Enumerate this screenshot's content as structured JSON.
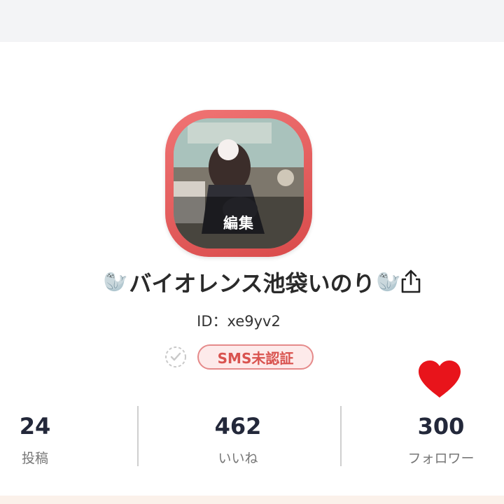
{
  "profile": {
    "edit_label": "編集",
    "name_prefix_emoji": "🦭",
    "display_name": "バイオレンス池袋いのり",
    "name_suffix_emoji": "🦭",
    "user_id": "ID：xe9yv2",
    "sms_status": "SMS未認証",
    "share_icon": "share-icon",
    "verify_icon": "check-circle-icon",
    "favorite_icon": "heart-icon"
  },
  "stats": [
    {
      "value": "24",
      "label": "投稿"
    },
    {
      "value": "462",
      "label": "いいね"
    },
    {
      "value": "300",
      "label": "フォロワー"
    }
  ],
  "colors": {
    "avatar_frame": "#e25a5a",
    "badge_text": "#d9534f",
    "badge_bg": "#fdeaea",
    "heart": "#e8141b",
    "stat_value": "#23283a"
  }
}
